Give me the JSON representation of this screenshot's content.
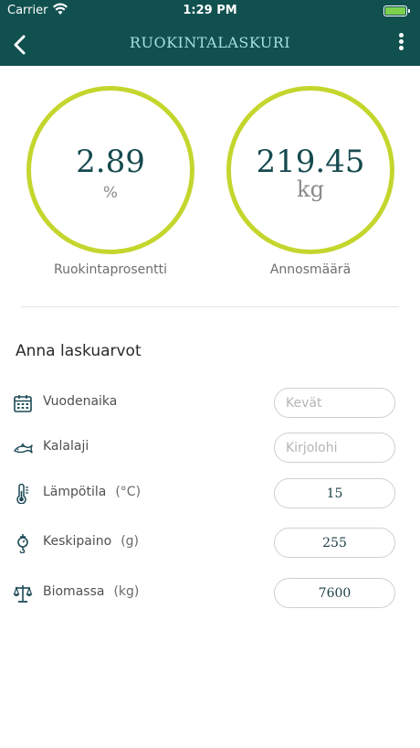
{
  "status_bar": {
    "carrier": "Carrier",
    "time": "1:29 PM",
    "battery_fill": 1.0,
    "battery_color": "#7bd14d"
  },
  "nav": {
    "title": "RUOKINTALASKURI",
    "back_icon": "chevron-left-icon",
    "menu_icon": "vertical-dots-icon",
    "bar_color": "#10504f"
  },
  "gauges": [
    {
      "value": "2.89",
      "unit": "%",
      "label": "Ruokintaprosentti"
    },
    {
      "value": "219.45",
      "unit": "kg",
      "label": "Annosmäärä"
    }
  ],
  "gauge_ring_color": "#c4d62d",
  "form": {
    "title": "Anna laskuarvot",
    "rows": [
      {
        "icon": "calendar-icon",
        "label": "Vuodenaika",
        "unit": "",
        "value": "",
        "placeholder": "Kevät"
      },
      {
        "icon": "fish-icon",
        "label": "Kalalaji",
        "unit": "",
        "value": "",
        "placeholder": "Kirjolohi"
      },
      {
        "icon": "thermometer-icon",
        "label": "Lämpötila",
        "unit": "(°C)",
        "value": "15",
        "placeholder": ""
      },
      {
        "icon": "hanging-scale-icon",
        "label": "Keskipaino",
        "unit": "(g)",
        "value": "255",
        "placeholder": ""
      },
      {
        "icon": "balance-scale-icon",
        "label": "Biomassa",
        "unit": "(kg)",
        "value": "7600",
        "placeholder": ""
      }
    ]
  }
}
